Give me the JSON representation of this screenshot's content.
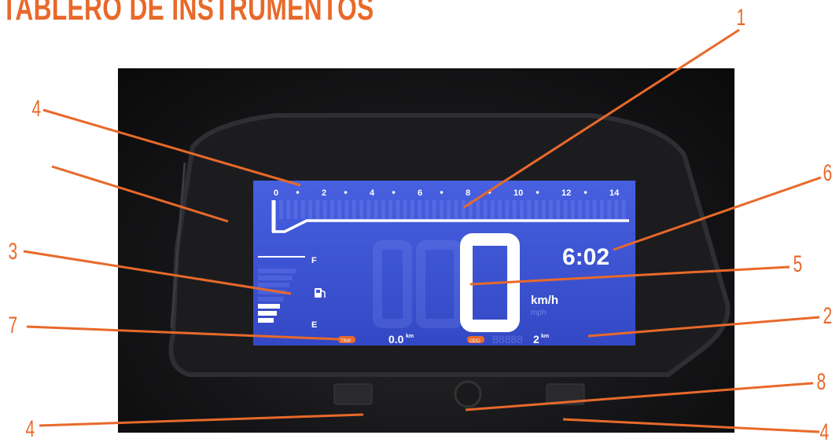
{
  "page": {
    "title": "TABLERO DE INSTRUMENTOS",
    "accent_color": "#e8692a",
    "lcd_color": "#3f56d8"
  },
  "dashboard": {
    "tach_ticks": [
      "0",
      "2",
      "4",
      "6",
      "8",
      "10",
      "12",
      "14"
    ],
    "fuel_full": "F",
    "fuel_empty": "E",
    "clock": "6:02",
    "speed": "0",
    "speed_unit": "km/h",
    "speed_unit_alt": "mph",
    "trip_label": "TRIP",
    "trip_value": "0.0",
    "trip_unit": "km",
    "odo_label": "ODO",
    "odo_value": "2",
    "odo_unit": "km",
    "fuel_icon": "fuel-pump-icon",
    "fuel_level": 0.4
  },
  "callouts": [
    {
      "id": "callout-1",
      "label": "1"
    },
    {
      "id": "callout-2",
      "label": "2"
    },
    {
      "id": "callout-3",
      "label": "3"
    },
    {
      "id": "callout-4a",
      "label": "4"
    },
    {
      "id": "callout-4b",
      "label": ""
    },
    {
      "id": "callout-4c",
      "label": "4"
    },
    {
      "id": "callout-4d",
      "label": "4"
    },
    {
      "id": "callout-5",
      "label": "5"
    },
    {
      "id": "callout-6",
      "label": "6"
    },
    {
      "id": "callout-7",
      "label": "7"
    },
    {
      "id": "callout-8",
      "label": "8"
    }
  ]
}
